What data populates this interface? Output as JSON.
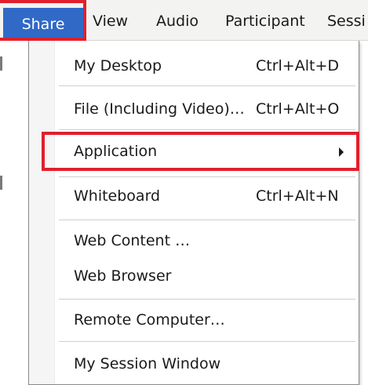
{
  "menubar": {
    "items": [
      {
        "label": "Share"
      },
      {
        "label": "View"
      },
      {
        "label": "Audio"
      },
      {
        "label": "Participant"
      },
      {
        "label": "Sessi"
      }
    ],
    "active_item": "Share"
  },
  "share_menu": {
    "items": [
      {
        "label": "My Desktop",
        "shortcut": "Ctrl+Alt+D"
      },
      {
        "label": "File (Including Video)…",
        "shortcut": "Ctrl+Alt+O"
      },
      {
        "label": "Application",
        "has_submenu": true,
        "highlighted": true
      },
      {
        "label": "Whiteboard",
        "shortcut": "Ctrl+Alt+N"
      },
      {
        "label": "Web Content …"
      },
      {
        "label": "Web Browser"
      },
      {
        "label": "Remote Computer…"
      },
      {
        "label": "My Session Window"
      }
    ]
  },
  "colors": {
    "menubar_bg": "#f3f3f2",
    "active_menu_bg": "#3169c6",
    "highlight_border": "#e0202c",
    "text": "#1a1a1a"
  }
}
